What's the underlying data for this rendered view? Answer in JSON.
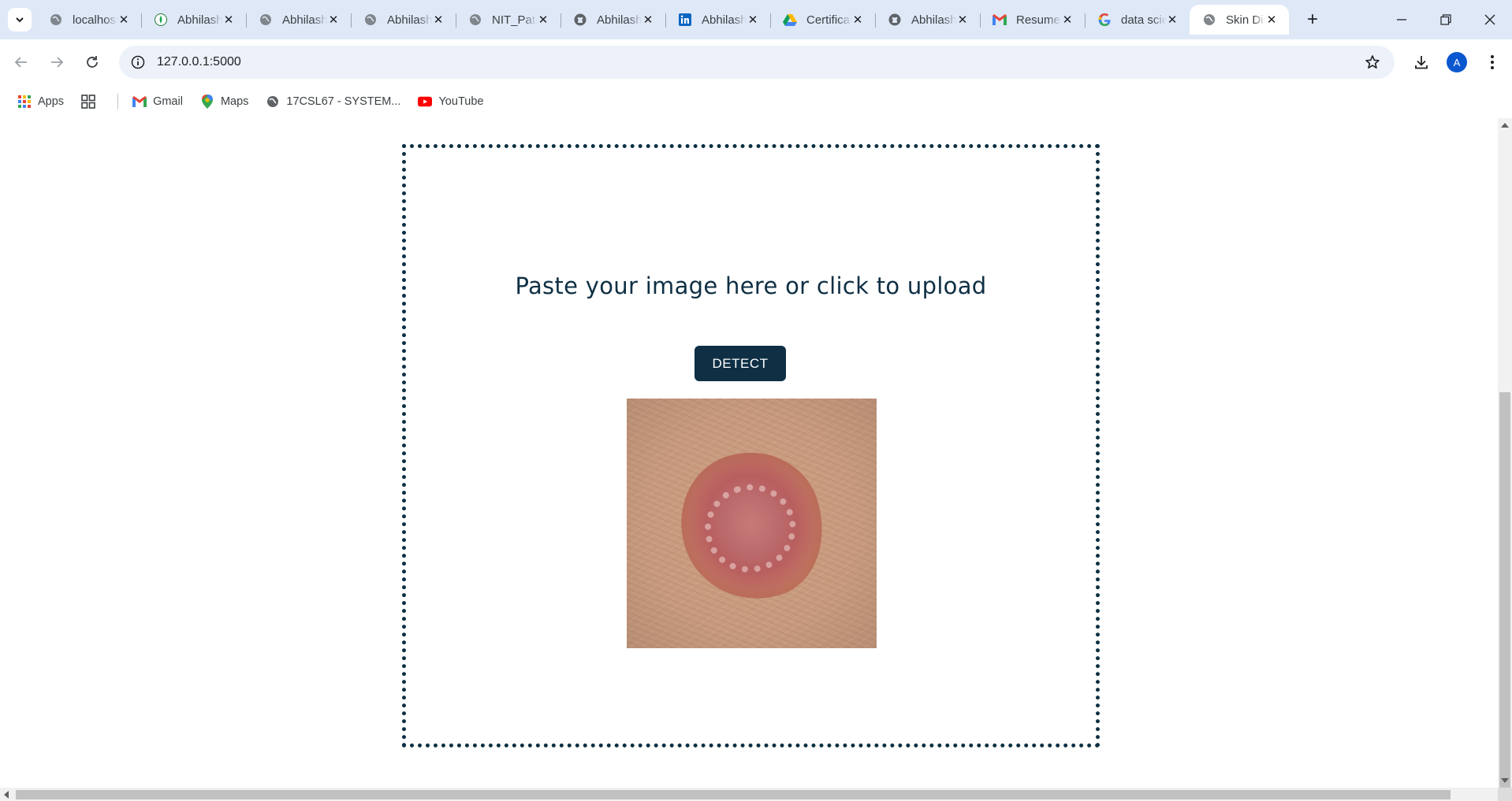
{
  "browser": {
    "tabs": [
      {
        "title": "localhost",
        "favicon": "globe-icon"
      },
      {
        "title": "Abhilash",
        "favicon": "mongodb-leaf-icon"
      },
      {
        "title": "Abhilash",
        "favicon": "globe-icon"
      },
      {
        "title": "Abhilash",
        "favicon": "globe-icon"
      },
      {
        "title": "NIT_Patna",
        "favicon": "globe-icon"
      },
      {
        "title": "Abhilash",
        "favicon": "github-icon"
      },
      {
        "title": "Abhilash",
        "favicon": "linkedin-icon"
      },
      {
        "title": "Certificate",
        "favicon": "google-drive-icon"
      },
      {
        "title": "Abhilash",
        "favicon": "github-icon"
      },
      {
        "title": "Resume",
        "favicon": "gmail-icon"
      },
      {
        "title": "data science",
        "favicon": "google-icon"
      },
      {
        "title": "Skin Disease",
        "favicon": "globe-icon",
        "active": true
      }
    ],
    "address_bar": {
      "url": "127.0.0.1:5000"
    },
    "profile_initial": "A",
    "bookmarks": [
      {
        "label": "Apps",
        "icon": "apps-grid-icon"
      },
      {
        "label": "",
        "icon": "tab-groups-icon"
      },
      {
        "label": "Gmail",
        "icon": "gmail-icon"
      },
      {
        "label": "Maps",
        "icon": "maps-pin-icon"
      },
      {
        "label": "17CSL67 - SYSTEM...",
        "icon": "globe-icon"
      },
      {
        "label": "YouTube",
        "icon": "youtube-icon"
      }
    ]
  },
  "page": {
    "upload_prompt": "Paste your image here or click to upload",
    "detect_button": "DETECT",
    "preview_image": "skin-lesion-photo"
  },
  "colors": {
    "accent": "#0e2f44",
    "tabstrip_bg": "#dee8f7",
    "omnibox_bg": "#edf2fa"
  }
}
